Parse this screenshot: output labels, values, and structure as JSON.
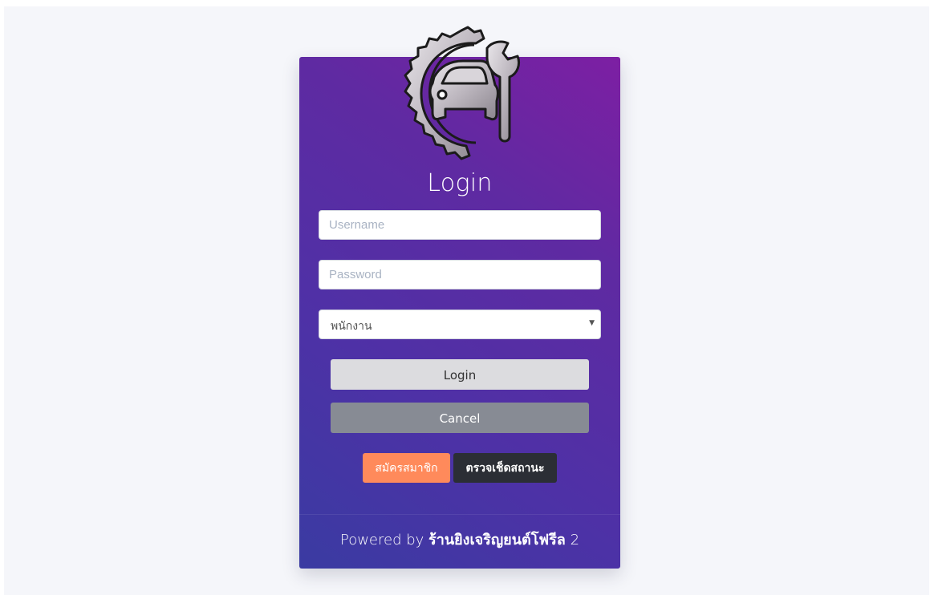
{
  "login": {
    "title": "Login",
    "username_placeholder": "Username",
    "password_placeholder": "Password",
    "role_selected": "พนักงาน",
    "login_button": "Login",
    "cancel_button": "Cancel",
    "register_button": "สมัครสมาชิก",
    "status_button": "ตรวจเช็ดสถานะ"
  },
  "footer": {
    "powered_by": "Powered by",
    "shop_name": "ร้านยิงเจริญยนต์โฟรีล",
    "suffix": "2"
  },
  "colors": {
    "card_top": "#7d1fa3",
    "card_bottom": "#3a3ba2",
    "register": "#ff8a5b",
    "status": "#2b2e35",
    "cancel": "#878b94",
    "login": "#dcdcdf"
  },
  "icons": {
    "logo": "gear-car-wrench-icon",
    "select_caret": "caret-down-icon"
  }
}
